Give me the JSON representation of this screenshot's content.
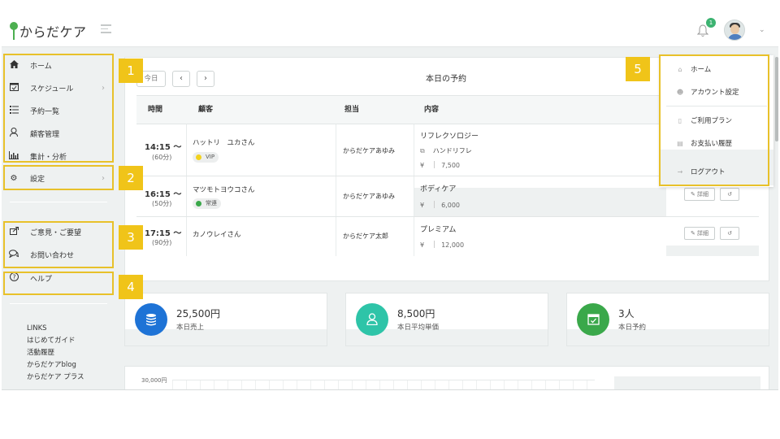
{
  "app": {
    "logo_text": "からだケア",
    "notification_count": "1"
  },
  "sidebar": {
    "items": [
      {
        "label": "ホーム",
        "icon": "home-icon"
      },
      {
        "label": "スケジュール",
        "icon": "calendar-check-icon"
      },
      {
        "label": "予約一覧",
        "icon": "list-icon"
      },
      {
        "label": "顧客管理",
        "icon": "user-icon"
      },
      {
        "label": "集計・分析",
        "icon": "bar-chart-icon"
      },
      {
        "label": "設定",
        "icon": "gear-icon"
      },
      {
        "label": "ご意見・ご要望",
        "icon": "share-icon"
      },
      {
        "label": "お問い合わせ",
        "icon": "chat-icon"
      },
      {
        "label": "ヘルプ",
        "icon": "question-circle-icon"
      }
    ],
    "links_heading": "LINKS",
    "links": [
      "はじめてガイド",
      "活動履歴",
      "からだケアblog",
      "からだケア プラス"
    ]
  },
  "reservations": {
    "today_button": "今日",
    "title": "本日の予約",
    "columns": [
      "時間",
      "顧客",
      "担当",
      "内容"
    ],
    "rows": [
      {
        "time": "14:15 〜",
        "duration": "(60分)",
        "customer": "ハットリ　ユカさん",
        "tag": "VIP",
        "tag_color": "#f2d21e",
        "staff": "からだケアあゆみ",
        "service": "リフレクソロジー",
        "option": "ハンドリフレ",
        "currency": "¥",
        "price": "7,500"
      },
      {
        "time": "16:15 〜",
        "duration": "(50分)",
        "customer": "マツモトヨウコさん",
        "tag": "常連",
        "tag_color": "#3aa84a",
        "staff": "からだケアあゆみ",
        "service": "ボディケア",
        "option": "",
        "currency": "¥",
        "price": "6,000"
      },
      {
        "time": "17:15 〜",
        "duration": "(90分)",
        "customer": "カノウレイさん",
        "tag": "",
        "tag_color": "",
        "staff": "からだケア太郎",
        "service": "プレミアム",
        "option": "",
        "currency": "¥",
        "price": "12,000"
      }
    ],
    "detail_button": "詳細",
    "undo_icon": "undo-icon"
  },
  "stats": [
    {
      "value": "25,500円",
      "label": "本日売上",
      "color": "#1e73d6",
      "icon": "coins-icon"
    },
    {
      "value": "8,500円",
      "label": "本日平均単価",
      "color": "#2ec4a8",
      "icon": "user-icon"
    },
    {
      "value": "3人",
      "label": "本日予約",
      "color": "#3aa84a",
      "icon": "calendar-check-icon"
    }
  ],
  "chart": {
    "y_tick_top": "30,000円"
  },
  "user_menu": {
    "items": [
      {
        "label": "ホーム",
        "icon": "home-icon"
      },
      {
        "label": "アカウント設定",
        "icon": "user-circle-icon"
      },
      {
        "label": "ご利用プラン",
        "icon": "bookmark-icon"
      },
      {
        "label": "お支払い履歴",
        "icon": "credit-card-icon"
      },
      {
        "label": "ログアウト",
        "icon": "logout-icon"
      }
    ]
  },
  "annotations": [
    "1",
    "2",
    "3",
    "4",
    "5"
  ],
  "colors": {
    "annotation": "#f0c419",
    "brand_green": "#4caf50"
  }
}
